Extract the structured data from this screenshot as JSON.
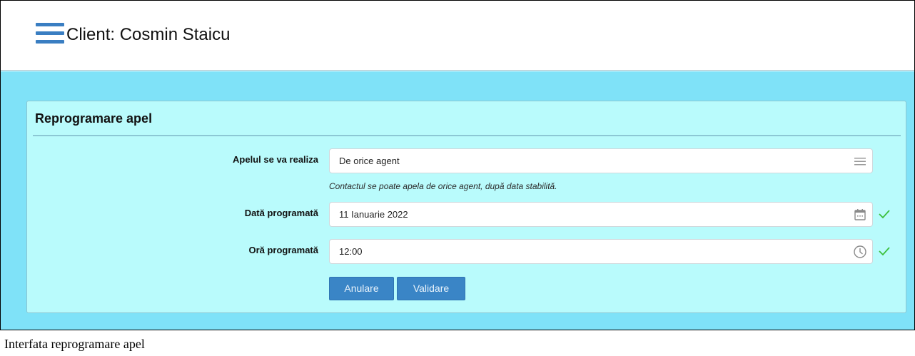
{
  "header": {
    "menu_icon": "hamburger-menu-icon",
    "title": "Client: Cosmin Staicu"
  },
  "panel": {
    "title": "Reprogramare apel",
    "fields": {
      "caller": {
        "label": "Apelul se va realiza",
        "value": "De orice agent",
        "icon": "list-icon",
        "help": "Contactul se poate apela de orice agent, după data stabilită."
      },
      "date": {
        "label": "Dată programată",
        "value": "11 Ianuarie 2022",
        "icon": "calendar-icon",
        "status_icon": "check-icon"
      },
      "time": {
        "label": "Oră programată",
        "value": "12:00",
        "icon": "clock-icon",
        "status_icon": "check-icon"
      }
    },
    "buttons": {
      "cancel": "Anulare",
      "validate": "Validare"
    }
  },
  "caption": "Interfata reprogramare apel",
  "colors": {
    "accent": "#3a85c6",
    "background": "#7fe2f8",
    "panel": "#b9fbfc",
    "valid": "#3bbf3b"
  }
}
